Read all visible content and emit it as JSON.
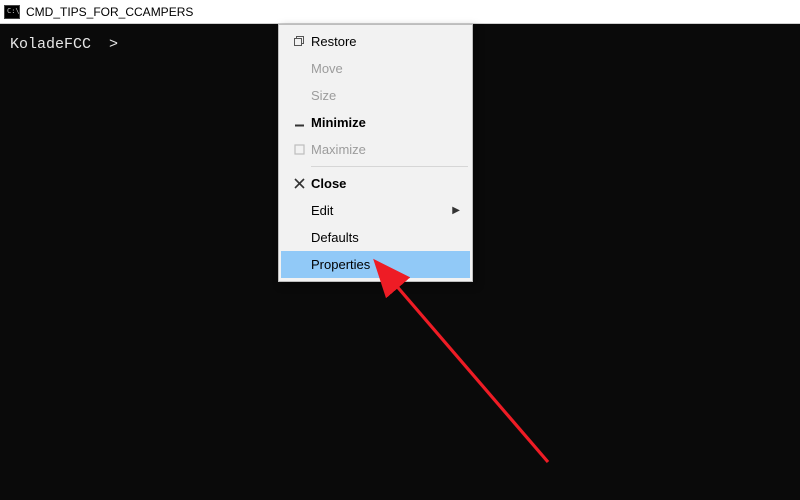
{
  "titlebar": {
    "icon_text": "C:\\",
    "title": "CMD_TIPS_FOR_CCAMPERS"
  },
  "terminal": {
    "prompt": "KoladeFCC  >"
  },
  "menu": {
    "restore": "Restore",
    "move": "Move",
    "size": "Size",
    "minimize": "Minimize",
    "maximize": "Maximize",
    "close": "Close",
    "edit": "Edit",
    "defaults": "Defaults",
    "properties": "Properties"
  },
  "colors": {
    "highlight": "#91c9f7",
    "arrow_red": "#ee1c25",
    "terminal_bg": "#0a0a0a"
  }
}
